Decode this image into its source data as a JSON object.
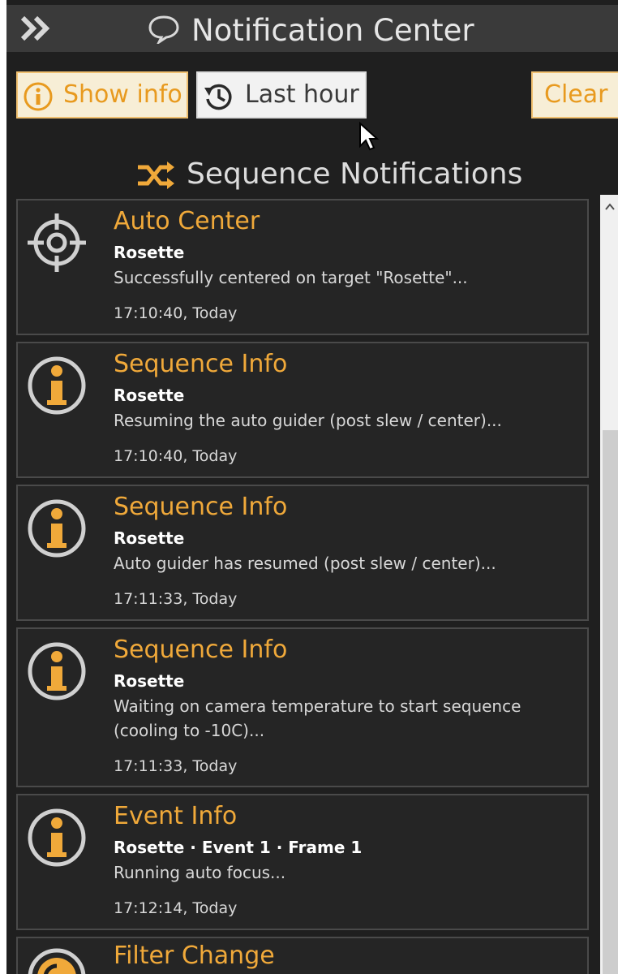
{
  "header": {
    "title": "Notification Center"
  },
  "toolbar": {
    "show_info_label": "Show info",
    "last_hour_label": "Last hour",
    "clear_label": "Clear"
  },
  "section": {
    "title": "Sequence Notifications"
  },
  "notifications": [
    {
      "icon": "crosshair-icon",
      "title": "Auto Center",
      "target": "Rosette",
      "message": "Successfully centered on target \"Rosette\"...",
      "time": "17:10:40, Today"
    },
    {
      "icon": "info-icon",
      "title": "Sequence Info",
      "target": "Rosette",
      "message": "Resuming the auto guider (post slew / center)...",
      "time": "17:10:40, Today"
    },
    {
      "icon": "info-icon",
      "title": "Sequence Info",
      "target": "Rosette",
      "message": "Auto guider has resumed (post slew / center)...",
      "time": "17:11:33, Today"
    },
    {
      "icon": "info-icon",
      "title": "Sequence Info",
      "target": "Rosette",
      "message": "Waiting on camera temperature to start sequence (cooling to -10C)...",
      "time": "17:11:33, Today"
    },
    {
      "icon": "info-icon",
      "title": "Event Info",
      "target": "Rosette · Event 1 · Frame 1",
      "message": "Running auto focus...",
      "time": "17:12:14, Today"
    },
    {
      "icon": "filter-icon",
      "title": "Filter Change",
      "target": "",
      "message": "",
      "time": ""
    }
  ],
  "colors": {
    "accent": "#f0a93a",
    "panel_background": "#1f1f1f",
    "card_border": "#4a4a4a",
    "title_bar": "#3a3a3a"
  }
}
